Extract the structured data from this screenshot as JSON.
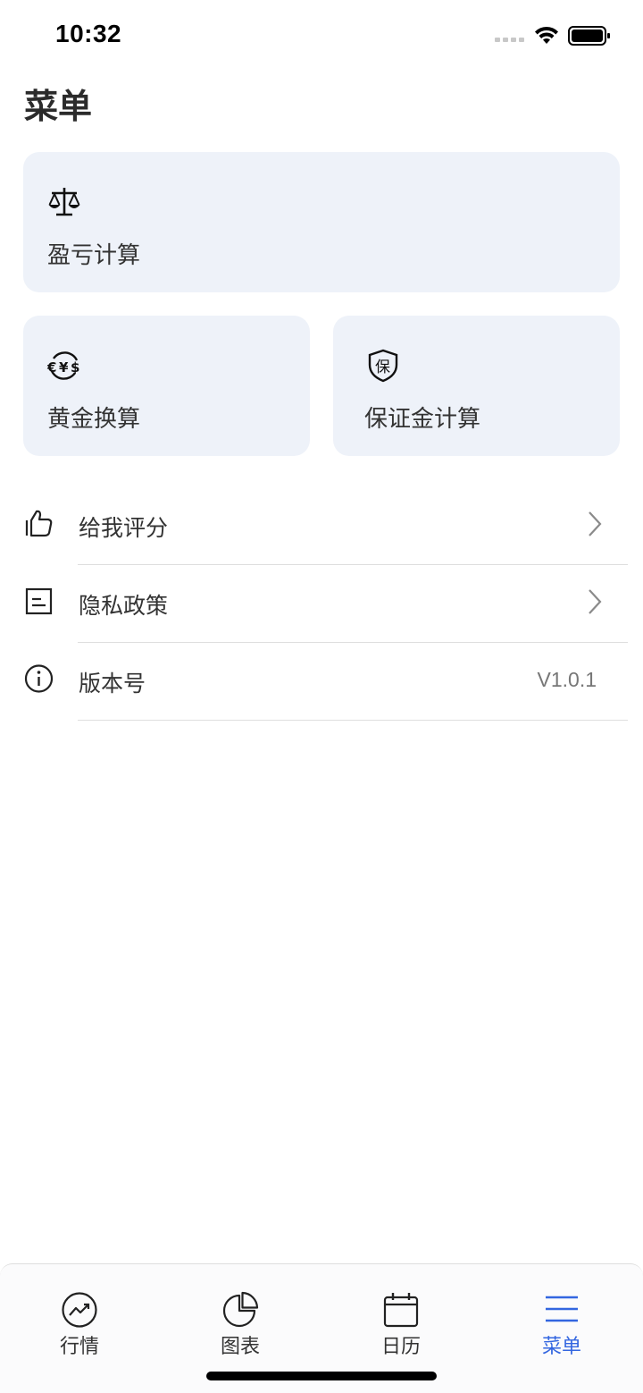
{
  "status_bar": {
    "time": "10:32"
  },
  "page": {
    "title": "菜单"
  },
  "cards": {
    "profit_loss": {
      "label": "盈亏计算",
      "icon": "scale-icon"
    },
    "gold_convert": {
      "label": "黄金换算",
      "icon": "currency-exchange-icon"
    },
    "margin": {
      "label": "保证金计算",
      "icon": "shield-bao-icon",
      "icon_char": "保"
    }
  },
  "menu": {
    "rate": {
      "label": "给我评分",
      "icon": "thumbs-up-icon"
    },
    "privacy": {
      "label": "隐私政策",
      "icon": "document-icon"
    },
    "version": {
      "label": "版本号",
      "value": "V1.0.1",
      "icon": "info-icon"
    }
  },
  "tab_bar": {
    "tabs": [
      {
        "label": "行情",
        "icon": "trend-circle-icon",
        "active": false
      },
      {
        "label": "图表",
        "icon": "pie-chart-icon",
        "active": false
      },
      {
        "label": "日历",
        "icon": "calendar-icon",
        "active": false
      },
      {
        "label": "菜单",
        "icon": "hamburger-menu-icon",
        "active": true
      }
    ]
  },
  "colors": {
    "accent": "#3366e0",
    "card_bg": "#eef2f9",
    "text": "#333333"
  }
}
